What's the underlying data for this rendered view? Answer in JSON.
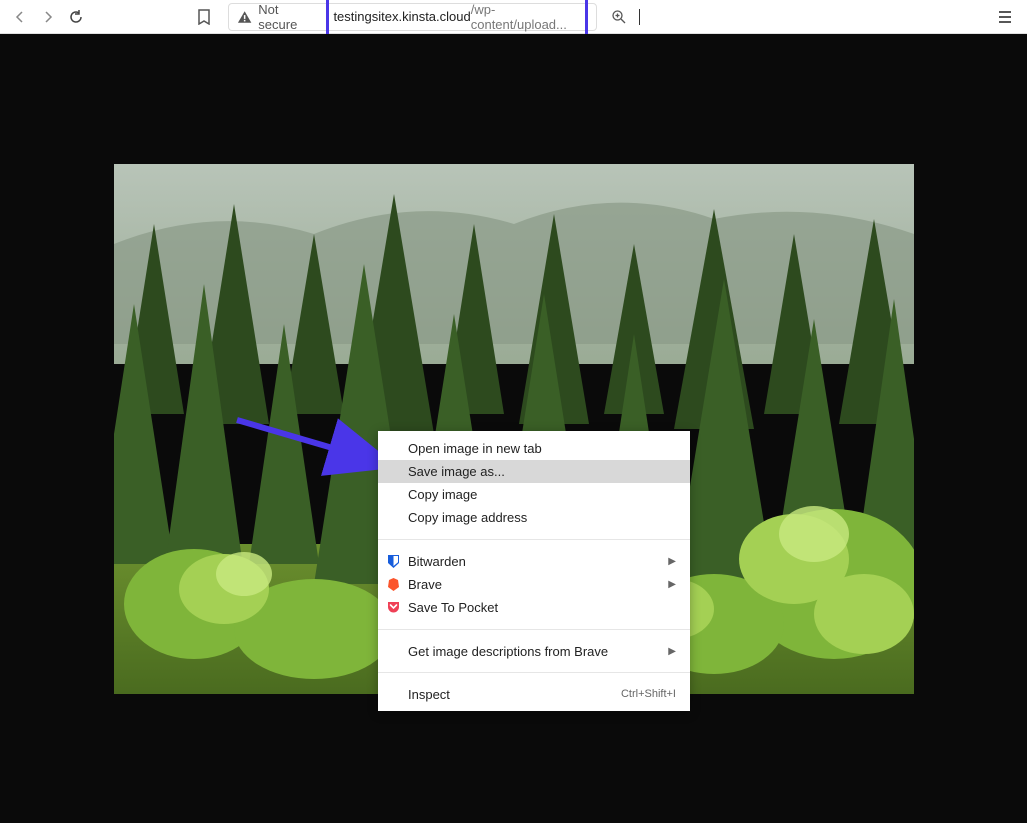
{
  "toolbar": {
    "security_label": "Not secure",
    "url_host": "testingsitex.kinsta.cloud",
    "url_path": "/wp-content/upload..."
  },
  "context_menu": {
    "items": [
      {
        "label": "Open image in new tab"
      },
      {
        "label": "Save image as...",
        "selected": true
      },
      {
        "label": "Copy image"
      },
      {
        "label": "Copy image address"
      }
    ],
    "ext_items": [
      {
        "label": "Bitwarden",
        "icon": "bitwarden",
        "submenu": true
      },
      {
        "label": "Brave",
        "icon": "brave",
        "submenu": true
      },
      {
        "label": "Save To Pocket",
        "icon": "pocket"
      }
    ],
    "more_items": [
      {
        "label": "Get image descriptions from Brave",
        "submenu": true
      }
    ],
    "dev_items": [
      {
        "label": "Inspect",
        "shortcut": "Ctrl+Shift+I"
      }
    ]
  }
}
